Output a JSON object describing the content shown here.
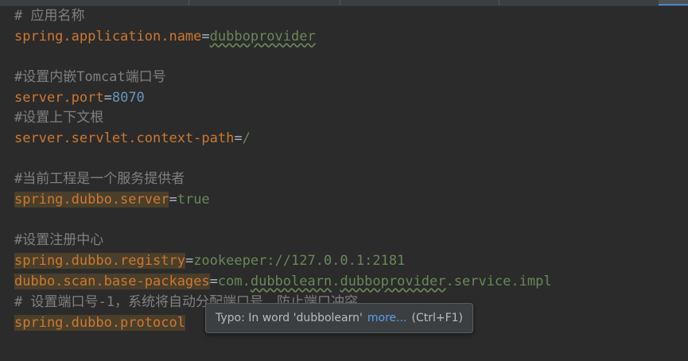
{
  "editor": {
    "lines": [
      {
        "comment": "# 应用名称"
      },
      {
        "key": "spring.application.name",
        "eq": "=",
        "val": "dubboprovider"
      },
      {
        "comment": "#设置内嵌Tomcat端口号"
      },
      {
        "key": "server.port",
        "eq": "=",
        "val": "8070"
      },
      {
        "comment": "#设置上下文根"
      },
      {
        "key": "server.servlet.context-path",
        "eq": "=",
        "val": "/"
      },
      {
        "comment": "#当前工程是一个服务提供者"
      },
      {
        "key": "spring.dubbo.server",
        "eq": "=",
        "val": "true"
      },
      {
        "comment": "#设置注册中心"
      },
      {
        "key": "spring.dubbo.registry",
        "eq": "=",
        "val": "zookeeper://127.0.0.1:2181"
      },
      {
        "key": "dubbo.scan.base-packages",
        "eq": "=",
        "val_a": "com.",
        "val_b": "dubbolearn",
        "val_c": ".",
        "val_d": "dubboprovider",
        "val_e": ".service.impl"
      },
      {
        "comment": "# 设置端口号-1，系统将自动分配端口号，防止端口冲突"
      },
      {
        "key": "spring.dubbo.protocol"
      }
    ]
  },
  "tooltip": {
    "message": "Typo: In word 'dubbolearn'",
    "link": "more...",
    "shortcut": "(Ctrl+F1)"
  },
  "colors": {
    "background": "#2b2b2b",
    "key": "#cc7832",
    "comment": "#808080",
    "string_value": "#6a8759",
    "number_value": "#6897bb"
  }
}
